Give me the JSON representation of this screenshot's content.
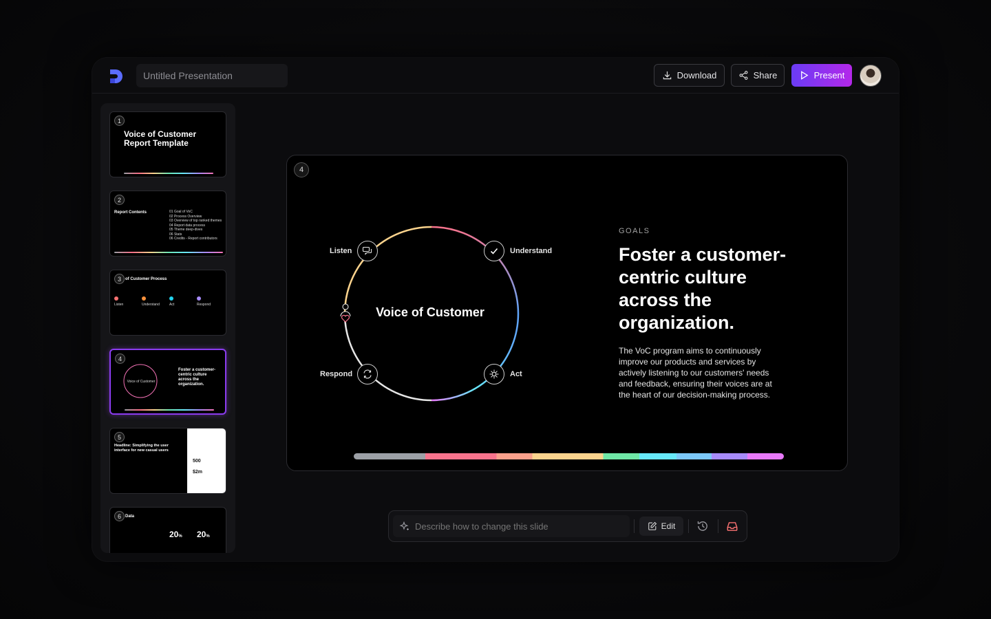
{
  "topbar": {
    "title_value": "Untitled Presentation",
    "download_label": "Download",
    "share_label": "Share",
    "present_label": "Present",
    "accent_gradient": [
      "#6a3cf5",
      "#b428ea"
    ]
  },
  "sidebar": {
    "thumbs": [
      {
        "num": "1",
        "title": "Voice of Customer Report Template"
      },
      {
        "num": "2",
        "title": "Report Contents",
        "items": [
          "01 Goal of VoC",
          "02 Process Overview",
          "03 Overview of top ranked themes",
          "04 Report data process",
          "05 Theme deep-dives",
          "06 Stats",
          "06 Credits - Report contributors"
        ]
      },
      {
        "num": "3",
        "title": "of Customer Process",
        "steps": [
          "Listen",
          "Understand",
          "Act",
          "Respond"
        ]
      },
      {
        "num": "4",
        "ring": "Voice of Customer",
        "head": "Foster a customer-centric culture across the organization."
      },
      {
        "num": "5",
        "title": "Headline: Simplifying the user interface for new casual users",
        "stat1": "500",
        "stat2": "$2m"
      },
      {
        "num": "6",
        "title": "Data",
        "stat": "20",
        "unit": "%"
      }
    ]
  },
  "slide": {
    "number": "4",
    "center_title": "Voice of Customer",
    "nodes": {
      "listen": "Listen",
      "understand": "Understand",
      "respond": "Respond",
      "act": "Act"
    },
    "kicker": "GOALS",
    "headline": "Foster a customer-centric culture across the organization.",
    "body": "The VoC program aims to continuously improve our products and services by actively listening to our customers' needs and feedback, ensuring their voices are at the heart of our decision-making process."
  },
  "prompt": {
    "placeholder": "Describe how to change this slide",
    "edit_label": "Edit"
  }
}
